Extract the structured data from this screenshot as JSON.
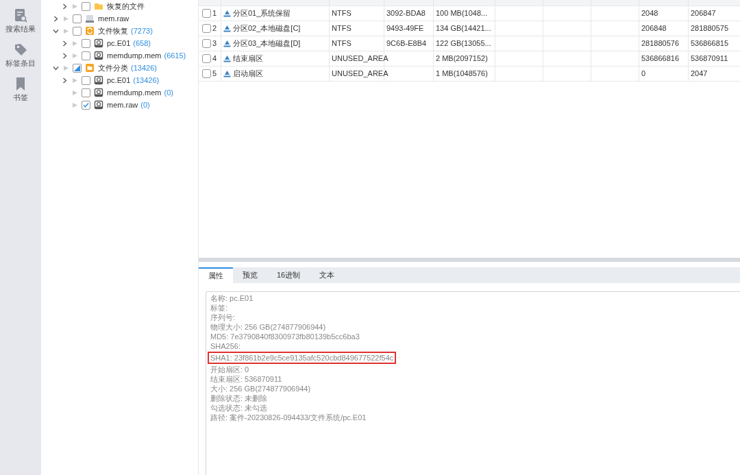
{
  "sidebar": {
    "items": [
      {
        "kind": "search",
        "label": "搜索结果"
      },
      {
        "kind": "tag",
        "label": "标签条目"
      },
      {
        "kind": "bookmark",
        "label": "书签"
      }
    ]
  },
  "tree": {
    "partial_branch": [
      {
        "label": "恢复的文件",
        "kind": "folder",
        "expanded": false,
        "checked": false
      }
    ],
    "items": [
      {
        "label": "mem.raw",
        "kind": "drive",
        "expanded": false,
        "checked": false
      },
      {
        "label": "文件恢复",
        "count": "(7273)",
        "kind": "recovery",
        "expanded": true,
        "checked": false,
        "children": [
          {
            "label": "pc.E01",
            "count": "(658)",
            "kind": "disk",
            "expanded": false,
            "checked": false
          },
          {
            "label": "memdump.mem",
            "count": "(6615)",
            "kind": "disk",
            "expanded": false,
            "checked": false
          }
        ]
      },
      {
        "label": "文件分类",
        "count": "(13426)",
        "kind": "category",
        "expanded": true,
        "partially_checked": true,
        "children": [
          {
            "label": "pc.E01",
            "count": "(13426)",
            "kind": "disk",
            "expanded": false,
            "checked": false
          },
          {
            "label": "memdump.mem",
            "count": "(0)",
            "kind": "disk",
            "checked": false
          },
          {
            "label": "mem.raw",
            "count": "(0)",
            "kind": "disk",
            "checked": true
          }
        ]
      }
    ]
  },
  "table": {
    "rows": [
      {
        "checked": false,
        "number": "1",
        "column_1": "分区01_系统保留",
        "column_2": "NTFS",
        "column_3": "3092-BDA8",
        "column_4": "100 MB(1048...",
        "column_8": "2048",
        "column_9": "206847"
      },
      {
        "checked": false,
        "number": "2",
        "column_1": "分区02_本地磁盘[C]",
        "column_2": "NTFS",
        "column_3": "9493-49FE",
        "column_4": "134 GB(14421...",
        "column_8": "206848",
        "column_9": "281880575"
      },
      {
        "checked": false,
        "number": "3",
        "column_1": "分区03_本地磁盘[D]",
        "column_2": "NTFS",
        "column_3": "9C6B-E8B4",
        "column_4": "122 GB(13055...",
        "column_8": "281880576",
        "column_9": "536866815"
      },
      {
        "checked": false,
        "number": "4",
        "column_1": "结束扇区",
        "column_2": "UNUSED_AREA",
        "column_4": "2 MB(2097152)",
        "column_8": "536866816",
        "column_9": "536870911"
      },
      {
        "checked": false,
        "number": "5",
        "column_1": "启动扇区",
        "column_2": "UNUSED_AREA",
        "column_4": "1 MB(1048576)",
        "column_8": "0",
        "column_9": "2047"
      }
    ]
  },
  "detail_tabs": [
    {
      "label": "属性",
      "selected": true
    },
    {
      "label": "预览",
      "selected": false
    },
    {
      "label": "16进制",
      "selected": false
    },
    {
      "label": "文本",
      "selected": false
    }
  ],
  "properties": [
    {
      "text": "名称: pc.E01",
      "highlighted": false
    },
    {
      "text": "标签:",
      "highlighted": false
    },
    {
      "text": "序列号:",
      "highlighted": false
    },
    {
      "text": "物理大小: 256 GB(274877906944)",
      "highlighted": false
    },
    {
      "text": "MD5: 7e3790840f8300973fb80139b5cc6ba3",
      "highlighted": false
    },
    {
      "text": "SHA256:",
      "highlighted": false
    },
    {
      "text": "SHA1: 23f861b2e9c5ce9135afc520cbd849677522f54c",
      "highlighted": true
    },
    {
      "text": "开始扇区: 0",
      "highlighted": false
    },
    {
      "text": "结束扇区: 536870911",
      "highlighted": false
    },
    {
      "text": "大小: 256 GB(274877906944)",
      "highlighted": false
    },
    {
      "text": "删除状态: 未删除",
      "highlighted": false
    },
    {
      "text": "勾选状态: 未勾选",
      "highlighted": false
    },
    {
      "text": "路径: 案件-20230826-094433/文件系统/pc.E01",
      "highlighted": false
    }
  ]
}
